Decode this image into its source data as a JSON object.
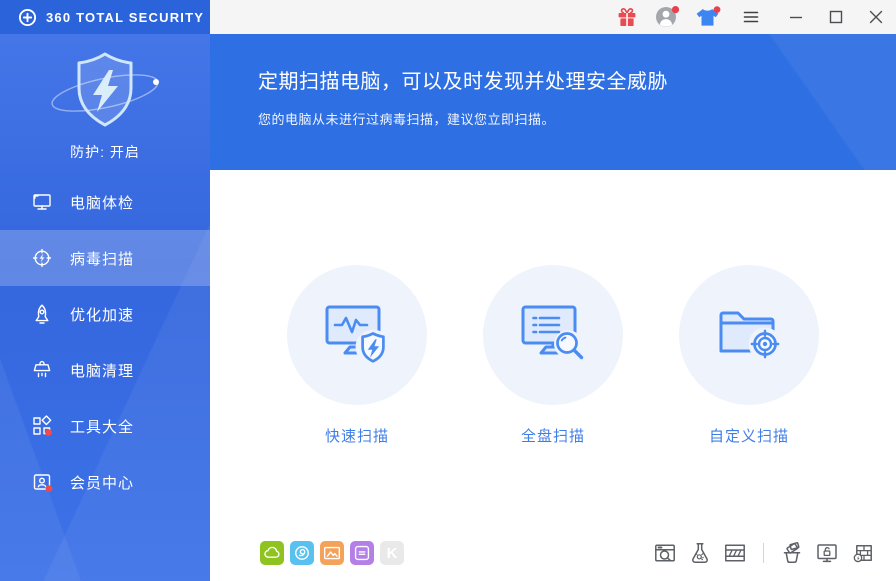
{
  "titlebar": {
    "app_title": "360 TOTAL SECURITY",
    "icons": [
      "gift-icon",
      "user-avatar",
      "theme-shirt-icon",
      "main-menu-icon",
      "minimize",
      "maximize",
      "close"
    ]
  },
  "sidebar": {
    "protection_label": "防护: 开启",
    "items": [
      {
        "label": "电脑体检",
        "icon": "monitor-icon",
        "selected": false,
        "badge": false
      },
      {
        "label": "病毒扫描",
        "icon": "virus-scan-icon",
        "selected": true,
        "badge": false
      },
      {
        "label": "优化加速",
        "icon": "rocket-icon",
        "selected": false,
        "badge": false
      },
      {
        "label": "电脑清理",
        "icon": "brush-icon",
        "selected": false,
        "badge": false
      },
      {
        "label": "工具大全",
        "icon": "toolbox-grid-icon",
        "selected": false,
        "badge": true
      },
      {
        "label": "会员中心",
        "icon": "member-icon",
        "selected": false,
        "badge": true
      }
    ]
  },
  "banner": {
    "title": "定期扫描电脑，可以及时发现并处理安全威胁",
    "subtitle": "您的电脑从未进行过病毒扫描，建议您立即扫描。"
  },
  "scan_options": [
    {
      "label": "快速扫描",
      "icon": "quick-scan-icon"
    },
    {
      "label": "全盘扫描",
      "icon": "full-scan-icon"
    },
    {
      "label": "自定义扫描",
      "icon": "custom-scan-icon"
    }
  ],
  "footer": {
    "left_apps": [
      {
        "name": "cloud-app",
        "color": "#8fc31f"
      },
      {
        "name": "spiral-app",
        "color": "#58c1f0"
      },
      {
        "name": "image-viewer-app",
        "color": "#f4a259"
      },
      {
        "name": "notes-app",
        "color": "#b47fe6"
      },
      {
        "name": "k-app",
        "color": "#e9e9e9",
        "glyph": "K"
      }
    ],
    "right_tools": [
      "scan-history",
      "virus-lab",
      "quarantine",
      "trust-zone",
      "screen-unlock",
      "firewall"
    ]
  },
  "colors": {
    "titlebar_blue": "#2b63db",
    "sidebar_blue": "#3a6fe4",
    "selected_item": "#5d88ec",
    "banner_blue": "#2e6fe3",
    "accent_blue": "#3f7de9",
    "circle_bg": "#eef3fc",
    "badge_red": "#ef4b4f",
    "tool_gray": "#5d6066"
  }
}
